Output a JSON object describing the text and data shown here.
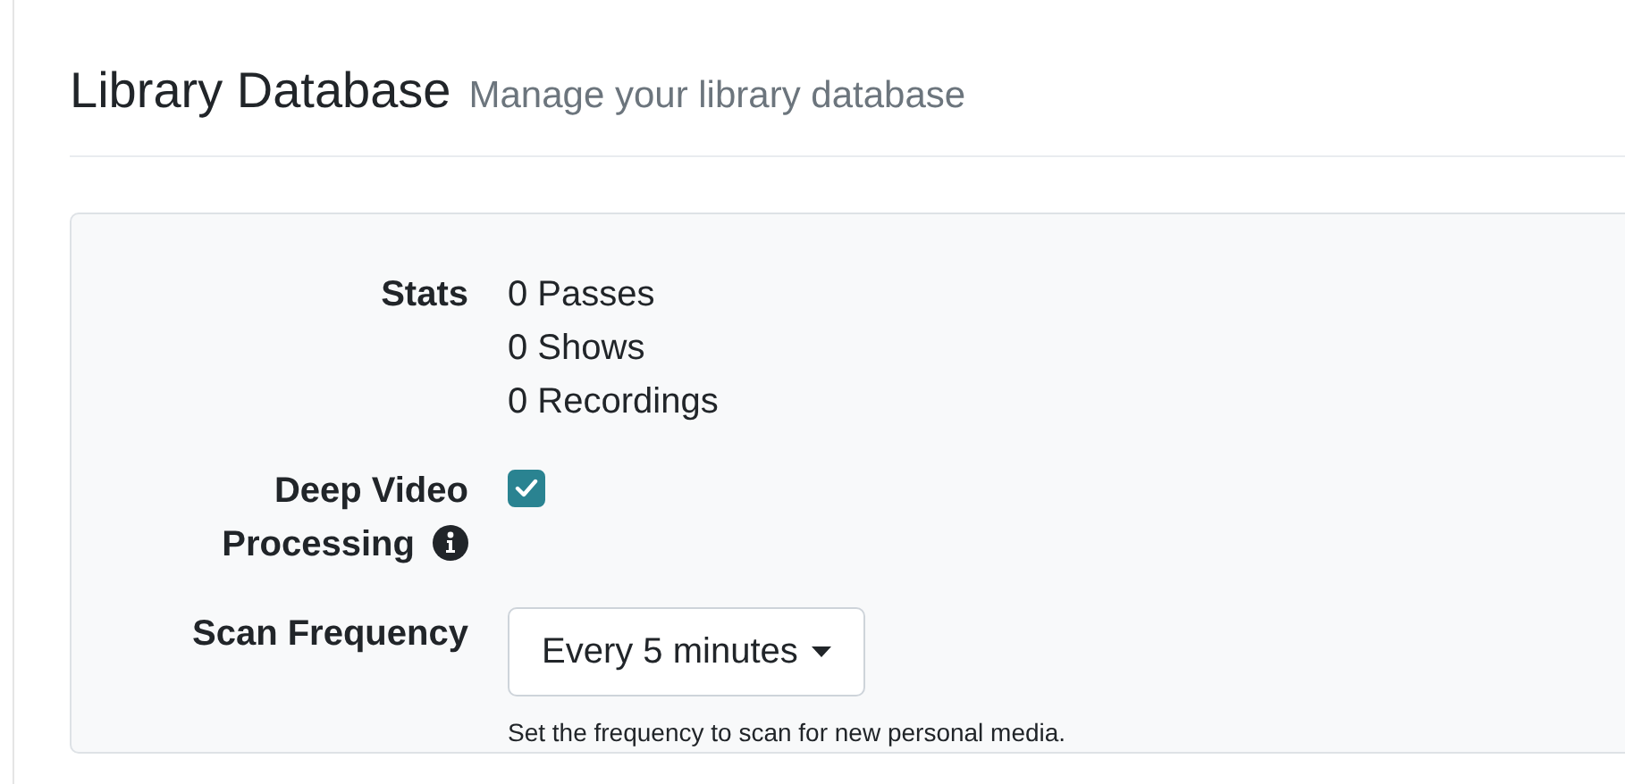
{
  "header": {
    "title": "Library Database",
    "subtitle": "Manage your library database"
  },
  "fields": [
    {
      "kind": "list",
      "label": "Stats",
      "lines": [
        "0 Passes",
        "0 Shows",
        "0 Recordings"
      ]
    },
    {
      "kind": "checkbox",
      "label": "Deep Video Processing",
      "info": true,
      "checked": true
    },
    {
      "kind": "dropdown",
      "label": "Scan Frequency",
      "value": "Every 5 minutes",
      "help": "Set the frequency to scan for new personal media."
    }
  ]
}
